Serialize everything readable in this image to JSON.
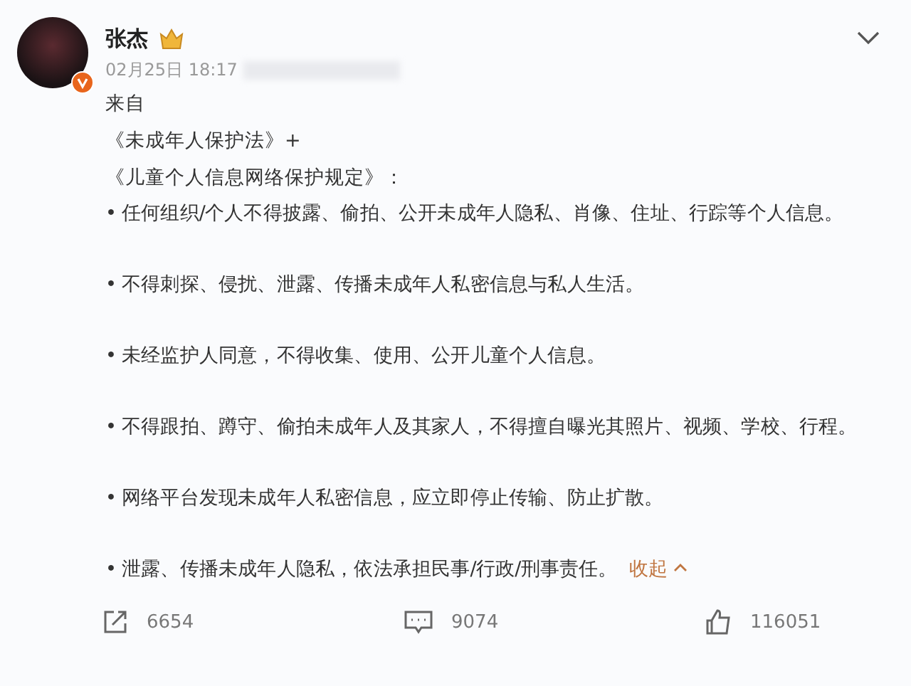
{
  "author": {
    "name": "张杰",
    "time": "02月25日 18:17"
  },
  "post": {
    "lines": [
      "来自",
      "《未成年人保护法》+",
      "《儿童个人信息网络保护规定》："
    ],
    "bullets": [
      "• 任何组织/个人不得披露、偷拍、公开未成年人隐私、肖像、住址、行踪等个人信息。",
      "• 不得刺探、侵扰、泄露、传播未成年人私密信息与私人生活。",
      "• 未经监护人同意，不得收集、使用、公开儿童个人信息。",
      "• 不得跟拍、蹲守、偷拍未成年人及其家人，不得擅自曝光其照片、视频、学校、行程。",
      "• 网络平台发现未成年人私密信息，应立即停止传输、防止扩散。",
      "• 泄露、传播未成年人隐私，依法承担民事/行政/刑事责任。"
    ],
    "collapse_link": "收起"
  },
  "stats": [
    {
      "kind": "share",
      "count": "6654"
    },
    {
      "kind": "comment",
      "count": "9074"
    },
    {
      "kind": "like",
      "count": "116051"
    }
  ]
}
